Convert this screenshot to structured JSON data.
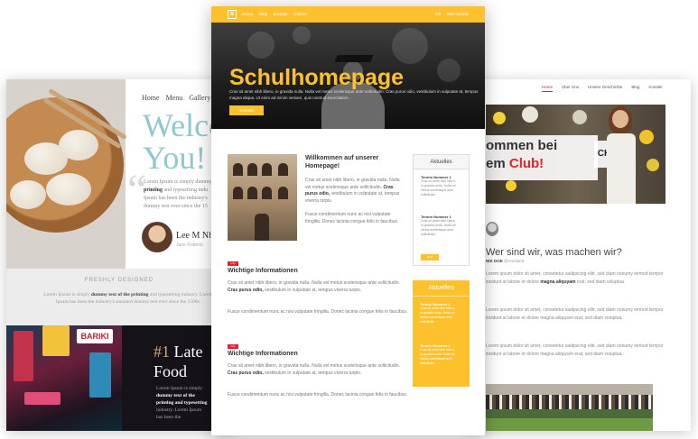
{
  "restaurant": {
    "nav": [
      "Home",
      "Menu",
      "Gallery",
      "Re"
    ],
    "welcome_line1": "Welco",
    "welcome_line2": "You!",
    "intro_lines": [
      "Lorem Ipsum is simply dummy te",
      "printing and typesetting indu",
      "Ipsum has been the industry's",
      "dummy text ever since the 15"
    ],
    "intro_bold": "printing",
    "author_name": "Lee M Nhai",
    "author_role": "Jane Roberts",
    "freshly_label": "FRESHLY DESIGNED",
    "mid_text_1": "Lorem Ipsum is simply ",
    "mid_text_bold": "dummy text of the printing",
    "mid_text_2": " and typesetting industry. Lorem Ipsum has been the industry's standard dummy text ever since the 1500s.",
    "late_hash": "#1",
    "late_word": "Late",
    "food_word": "Food",
    "bottom_lines": [
      "Lorem Ipsum is simply",
      "dummy text of the",
      "printing and typesetting",
      "industry. Lorem Ipsum",
      "has been the"
    ],
    "sign_text": "BARIKI"
  },
  "school": {
    "logo_letter": "S",
    "nav_left": [
      "Home",
      "Blog",
      "Kontakt",
      "Galerie"
    ],
    "nav_right": [
      "DE",
      "Wert Schule"
    ],
    "hero_title": "Schulhomepage",
    "hero_text_1": "Cras sit amet nibh libero, in gravida nulla. Nulla vel metus scelerisque ante sollicitudin. Cras purus odio, vestibulum in vulputate at, tempus",
    "hero_text_2": "magna aliqua. Ut enim ad minim veniam, quis nostrud exercitation.",
    "hero_button": "Kontakt",
    "welcome_heading": "Willkommen auf unserer Homepage!",
    "para_a_1": "Cras sit amet nibh libero, in gravida nulla. Nulla vel metus scelerisque ante sollicitudin. ",
    "para_a_bold": "Cras purus odio,",
    "para_a_2": " vestibulum in vulputate at, tempus viverra turpis.",
    "para_b": "Fusce condimentum nunc ac nisi vulputate fringilla. Donec lacinia congue felis in faucibus.",
    "badge": "Info",
    "section_title": "Wichtige Informationen",
    "sidebar_title": "Aktuelles",
    "event_title": "Termin Nummer 1",
    "event_text": [
      "Cras sit amet nibh libero,",
      "in gravida nulla. Nulla vel",
      "metus scelerisque ante",
      "sollicitudin."
    ],
    "more_button": "Mehr"
  },
  "club": {
    "nav": [
      "Home",
      "Über Uns",
      "Unsere Geschichte",
      "Blog",
      "Kontakt"
    ],
    "hero_line1": "ommen bei",
    "hero_line2a": "em ",
    "hero_line2b": "Club!",
    "heading": "Wer sind wir, was machen wir?",
    "author_name": "NIK DOE",
    "author_role": "@Vorstand",
    "para_1": "Lorem ipsum dolor sit amet, consetetur sadipscing elitr, sed diam nonumy eirmod tempor invidunt ut labore et dolore ",
    "para_bold": "magna aliquyam",
    "para_2": " erat, sed diam voluptua.",
    "para_plain": "Lorem ipsum dolor sit amet, consetetur sadipscing elitr, sed diam nonumy eirmod tempor invidunt ut labore et dolore magna aliquyam erat, sed diam voluptua.",
    "sign_text": "CK"
  },
  "colors": {
    "school_yellow": "#fdc12d",
    "club_red": "#e5212b",
    "restaurant_teal": "#8fc8cf"
  }
}
